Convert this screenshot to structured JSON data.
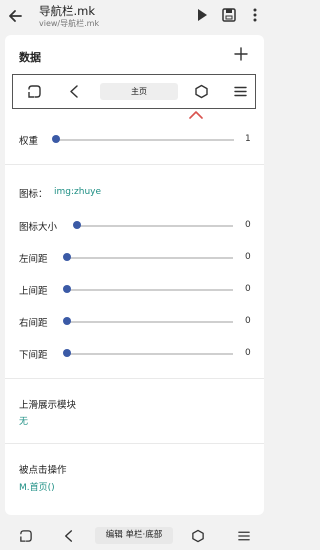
{
  "header": {
    "title": "导航栏.mk",
    "subtitle": "view/导航栏.mk"
  },
  "section": {
    "title": "数据"
  },
  "navbar_preview": {
    "home_label": "主页"
  },
  "weight": {
    "label": "权重",
    "value": "1",
    "level": 0.0
  },
  "icon": {
    "label": "图标：",
    "value": "img:zhuye"
  },
  "sliders": [
    {
      "label": "图标大小",
      "value": "0",
      "level": 0.0
    },
    {
      "label": "左间距",
      "value": "0",
      "level": 0.0
    },
    {
      "label": "上间距",
      "value": "0",
      "level": 0.0
    },
    {
      "label": "右间距",
      "value": "0",
      "level": 0.0
    },
    {
      "label": "下间距",
      "value": "0",
      "level": 0.0
    }
  ],
  "swipe_module": {
    "label": "上滑展示模块",
    "value": "无"
  },
  "click_action": {
    "label": "被点击操作",
    "value": "M.首页()"
  },
  "bottom_bar": {
    "label": "编辑 单栏·底部"
  },
  "colors": {
    "accent": "#3b5aa6",
    "link": "#1e8f84",
    "caret": "#d9534f"
  }
}
